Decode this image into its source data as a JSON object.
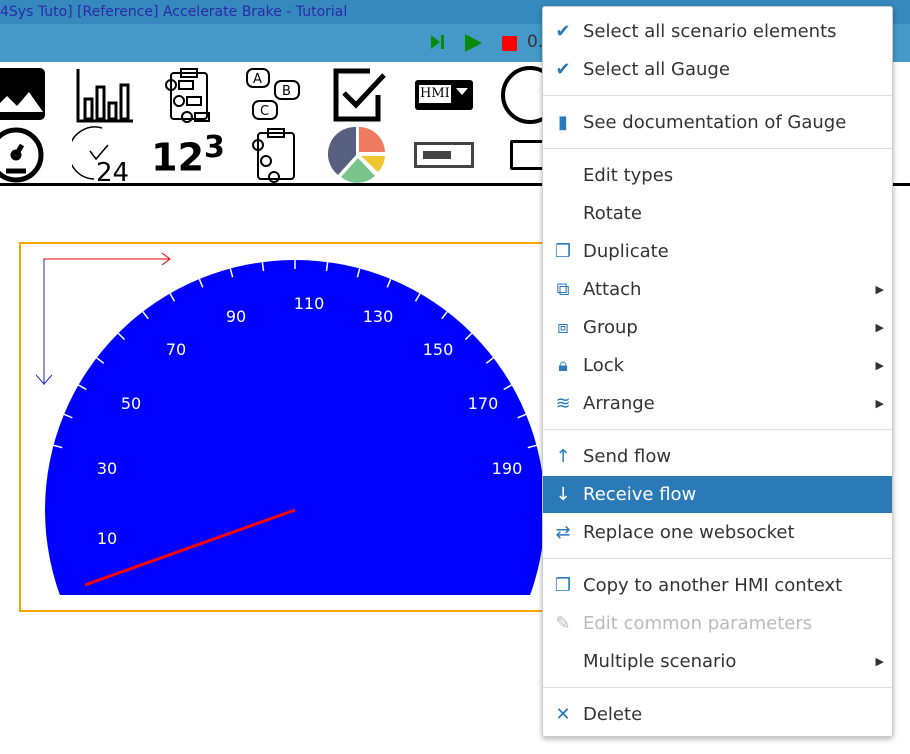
{
  "window": {
    "title": "4Sys Tuto] [Reference] Accelerate Brake - Tutorial"
  },
  "toolbar": {
    "step_icon": "step-forward-icon",
    "play_icon": "play-icon",
    "stop_icon": "stop-icon",
    "time_text": "0."
  },
  "palette": {
    "items": [
      "image",
      "bar-chart",
      "clipboard-list",
      "abc-buttons",
      "checkbox",
      "hmi-dropdown",
      "dpad",
      "gauge",
      "clock-24",
      "number-123",
      "clipboard-list-2",
      "pie-chart",
      "progress-bar",
      "rectangle"
    ],
    "hmi_label": "HMI"
  },
  "gauge": {
    "labels": [
      "10",
      "30",
      "50",
      "70",
      "90",
      "110",
      "130",
      "150",
      "170",
      "190"
    ],
    "color": "#0000ff",
    "needle_color": "#ff0000",
    "needle_value": 3
  },
  "menu": {
    "items": [
      {
        "label": "Select all scenario elements",
        "icon": "double-check-icon"
      },
      {
        "label": "Select all Gauge",
        "icon": "double-check-icon"
      },
      {
        "label": "See documentation of Gauge",
        "icon": "book-icon"
      },
      {
        "label": "Edit types",
        "icon": ""
      },
      {
        "label": "Rotate",
        "icon": ""
      },
      {
        "label": "Duplicate",
        "icon": "copy-icon"
      },
      {
        "label": "Attach",
        "icon": "attach-icon",
        "submenu": true
      },
      {
        "label": "Group",
        "icon": "group-icon",
        "submenu": true
      },
      {
        "label": "Lock",
        "icon": "lock-icon",
        "submenu": true
      },
      {
        "label": "Arrange",
        "icon": "layers-icon",
        "submenu": true
      },
      {
        "label": "Send flow",
        "icon": "arrow-up-icon"
      },
      {
        "label": "Receive flow",
        "icon": "arrow-down-icon",
        "highlighted": true
      },
      {
        "label": "Replace one websocket",
        "icon": "swap-icon"
      },
      {
        "label": "Copy to another HMI context",
        "icon": "copy-icon"
      },
      {
        "label": "Edit common parameters",
        "icon": "pencil-icon",
        "disabled": true
      },
      {
        "label": "Multiple scenario",
        "icon": "",
        "submenu": true
      },
      {
        "label": "Delete",
        "icon": "close-icon"
      }
    ]
  }
}
